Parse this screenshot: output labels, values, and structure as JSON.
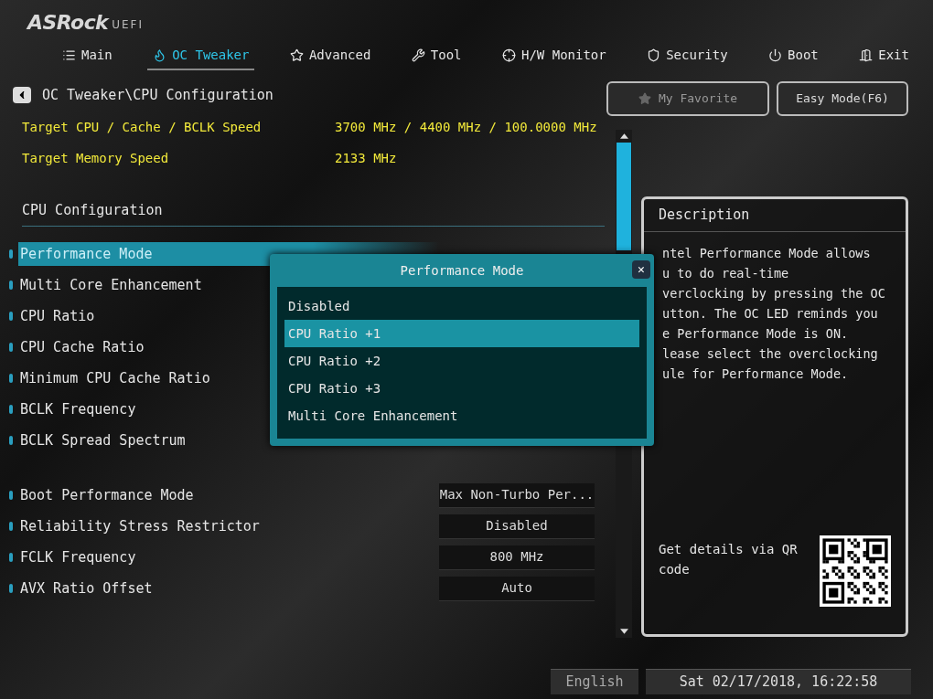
{
  "brand": {
    "logo": "ASRock",
    "suffix": "UEFI"
  },
  "tabs": [
    {
      "label": "Main",
      "selected": false
    },
    {
      "label": "OC Tweaker",
      "selected": true
    },
    {
      "label": "Advanced",
      "selected": false
    },
    {
      "label": "Tool",
      "selected": false
    },
    {
      "label": "H/W Monitor",
      "selected": false
    },
    {
      "label": "Security",
      "selected": false
    },
    {
      "label": "Boot",
      "selected": false
    },
    {
      "label": "Exit",
      "selected": false
    }
  ],
  "breadcrumb": "OC Tweaker\\CPU Configuration",
  "top_buttons": [
    {
      "label": "My Favorite",
      "kind": "favorite"
    },
    {
      "label": "Easy Mode(F6)",
      "kind": "plain"
    }
  ],
  "info_rows": [
    {
      "label": "Target CPU / Cache / BCLK Speed",
      "value": "3700 MHz / 4400 MHz / 100.0000 MHz"
    },
    {
      "label": "Target Memory Speed",
      "value": "2133 MHz"
    }
  ],
  "section_title": "CPU Configuration",
  "setting_groups": [
    [
      {
        "label": "Performance Mode",
        "selected": true
      },
      {
        "label": "Multi Core Enhancement",
        "selected": false
      },
      {
        "label": "CPU Ratio",
        "selected": false
      },
      {
        "label": "CPU Cache Ratio",
        "selected": false
      },
      {
        "label": "Minimum CPU Cache Ratio",
        "selected": false
      },
      {
        "label": "BCLK Frequency",
        "selected": false
      },
      {
        "label": "BCLK Spread Spectrum",
        "selected": false
      }
    ],
    [
      {
        "label": "Boot Performance Mode",
        "value": "Max Non-Turbo Per...",
        "selected": false
      },
      {
        "label": "Reliability Stress Restrictor",
        "value": "Disabled",
        "selected": false
      },
      {
        "label": "FCLK Frequency",
        "value": "800 MHz",
        "selected": false
      },
      {
        "label": "AVX Ratio Offset",
        "value": "Auto",
        "selected": false
      }
    ]
  ],
  "description": {
    "title": "Description",
    "lines": [
      "ntel Performance Mode allows",
      "u to do real-time",
      "verclocking by pressing the OC",
      "utton. The OC LED reminds you",
      "e Performance Mode is ON.",
      "lease select the overclocking",
      "ule for Performance Mode."
    ],
    "qr_text": "Get details via QR code"
  },
  "popup": {
    "title": "Performance Mode",
    "close": "✕",
    "options": [
      {
        "label": "Disabled",
        "selected": false
      },
      {
        "label": "CPU Ratio +1",
        "selected": true
      },
      {
        "label": "CPU Ratio +2",
        "selected": false
      },
      {
        "label": "CPU Ratio +3",
        "selected": false
      },
      {
        "label": "Multi Core Enhancement",
        "selected": false
      }
    ]
  },
  "footer": {
    "language": "English",
    "datetime": "Sat 02/17/2018, 16:22:58"
  }
}
